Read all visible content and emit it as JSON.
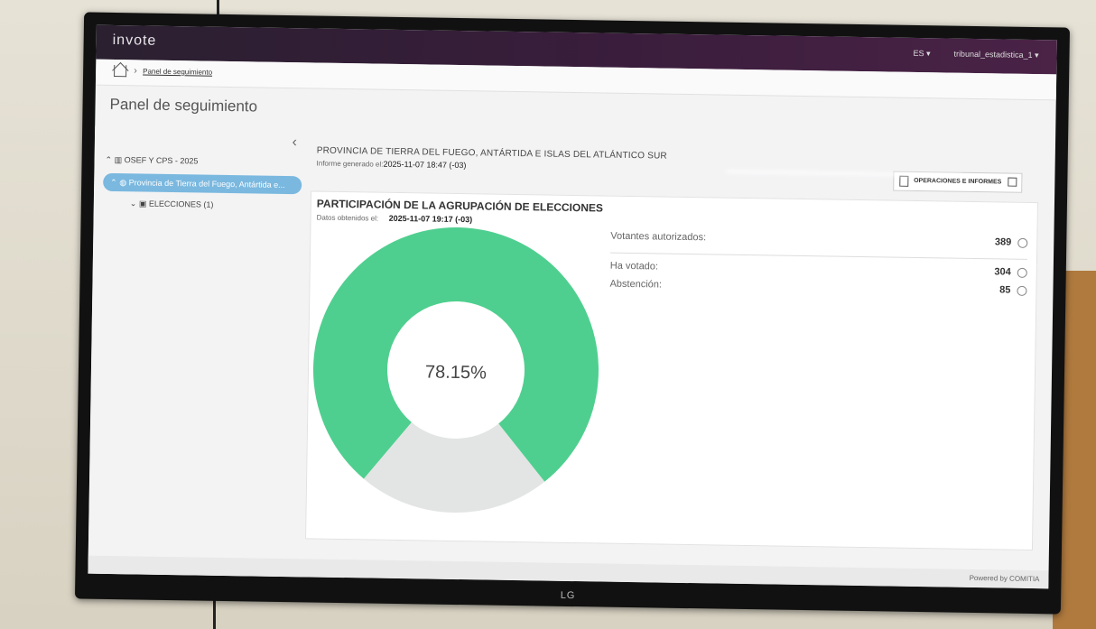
{
  "app": {
    "brand": "invote",
    "lang": "ES ▾",
    "user": "tribunal_estadistica_1 ▾"
  },
  "breadcrumb": {
    "item": "Panel de seguimiento"
  },
  "page": {
    "title": "Panel de seguimiento"
  },
  "sidebar": {
    "items": [
      {
        "label": "OSEF Y CPS - 2025"
      },
      {
        "label": "Provincia de Tierra del Fuego, Antártida e..."
      },
      {
        "label": "ELECCIONES (1)"
      }
    ]
  },
  "report": {
    "province": "PROVINCIA DE TIERRA DEL FUEGO, ANTÁRTIDA E ISLAS DEL ATLÁNTICO SUR",
    "generated_label": "Informe generado el:",
    "generated_date": "2025-11-07 18:47 (-03)",
    "ops_button": "OPERACIONES E INFORMES"
  },
  "participation": {
    "title": "PARTICIPACIÓN DE LA AGRUPACIÓN DE ELECCIONES",
    "data_label": "Datos obtenidos el:",
    "data_date": "2025-11-07 19:17 (-03)",
    "center_label": "78.15%",
    "stats": [
      {
        "label": "Votantes autorizados:",
        "value": "389"
      },
      {
        "label": "Ha votado:",
        "value": "304"
      },
      {
        "label": "Abstención:",
        "value": "85"
      }
    ]
  },
  "chart_data": {
    "type": "pie",
    "categories": [
      "Ha votado",
      "Abstención"
    ],
    "values": [
      304,
      85
    ],
    "colors": [
      "#4fcf8f",
      "#e3e4e4"
    ]
  },
  "footer": {
    "powered": "Powered by COMITIA"
  },
  "tv": {
    "brand": "LG"
  }
}
